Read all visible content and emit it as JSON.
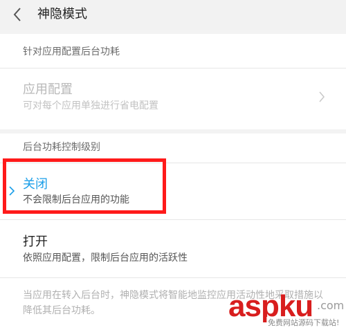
{
  "header": {
    "title": "神隐模式"
  },
  "section1": {
    "title": "针对应用配置后台功耗",
    "item": {
      "label": "应用配置",
      "sub": "可对每个应用单独进行省电配置"
    }
  },
  "section2": {
    "title": "后台功耗控制级别",
    "options": [
      {
        "label": "关闭",
        "sub": "不会限制后台应用的功能"
      },
      {
        "label": "打开",
        "sub": "依照应用配置，限制后台应用的活跃性"
      }
    ],
    "description": "当应用在转入后台时，神隐模式将智能地监控应用活动性地采取措施以降低其后台功耗。"
  },
  "watermark": {
    "logo": "aspku",
    "ext": ".com",
    "sub": "免费网站源码下载站!"
  },
  "colors": {
    "accent": "#1a9ee8",
    "highlight": "#ff1a1a"
  }
}
